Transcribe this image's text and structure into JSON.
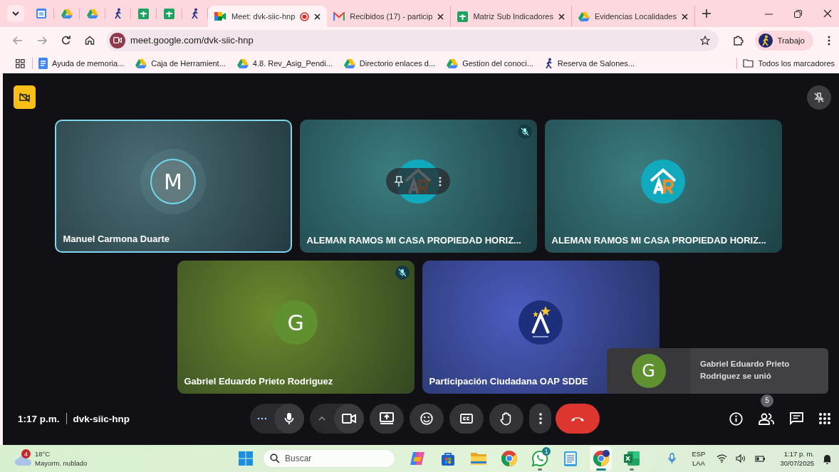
{
  "browser": {
    "tabs": [
      {
        "kind": "calendar",
        "selected": false
      },
      {
        "kind": "drive",
        "selected": false
      },
      {
        "kind": "drive",
        "selected": false
      },
      {
        "kind": "figure",
        "selected": false
      },
      {
        "kind": "sheets",
        "selected": false
      },
      {
        "kind": "sheets",
        "selected": false
      },
      {
        "kind": "figure",
        "selected": false
      },
      {
        "kind": "meet",
        "label": "Meet: dvk-siic-hnp",
        "recording": true,
        "selected": true
      },
      {
        "kind": "gmail",
        "label": "Recibidos (17) - particip",
        "recording": false,
        "selected": false
      },
      {
        "kind": "sheets",
        "label": "Matriz Sub Indicadores",
        "recording": false,
        "selected": false
      },
      {
        "kind": "drive",
        "label": "Evidencias Localidades",
        "recording": false,
        "selected": false
      }
    ],
    "url": "meet.google.com/dvk-siic-hnp",
    "profile": "Trabajo",
    "bookmarks": [
      {
        "kind": "doc",
        "label": "Ayuda de memoria..."
      },
      {
        "kind": "drive",
        "label": "Caja de Herramient..."
      },
      {
        "kind": "drive",
        "label": "4.8. Rev_Asig_Pendi..."
      },
      {
        "kind": "drive",
        "label": "Directorio enlaces d..."
      },
      {
        "kind": "drive",
        "label": "Gestion del conoci..."
      },
      {
        "kind": "figure",
        "label": "Reserva de Salones..."
      }
    ],
    "all_bookmarks": "Todos los marcadores"
  },
  "meet": {
    "tiles": [
      {
        "name": "Manuel Carmona Duarte",
        "kind": "letter",
        "letter": "M",
        "color": "#4a6e74",
        "speaking": true,
        "muted": false,
        "hovered": false
      },
      {
        "name": "ALEMAN RAMOS MI CASA PROPIEDAD HORIZ...",
        "kind": "house-logo",
        "color": "#3a7d80",
        "speaking": false,
        "muted": true,
        "hovered": true
      },
      {
        "name": "ALEMAN RAMOS MI CASA PROPIEDAD HORIZ...",
        "kind": "house-logo",
        "color": "#3a7d80",
        "speaking": false,
        "muted": false,
        "hovered": false
      },
      {
        "name": "Gabriel Eduardo Prieto Rodriguez",
        "kind": "letter",
        "letter": "G",
        "color": "#6b8a2c",
        "speaking": false,
        "muted": true,
        "hovered": false
      },
      {
        "name": "Participación Ciudadana OAP SDDE",
        "kind": "star-logo",
        "color": "#4b5cc0",
        "speaking": false,
        "muted": false,
        "hovered": false
      }
    ],
    "toast": {
      "letter": "G",
      "text": "Gabriel Eduardo Prieto Rodriguez se unió"
    },
    "time": "1:17 p.m.",
    "meeting_code": "dvk-siic-hnp",
    "controls": [
      {
        "kind": "mic"
      },
      {
        "kind": "camera"
      },
      {
        "kind": "present"
      },
      {
        "kind": "emoji"
      },
      {
        "kind": "captions"
      },
      {
        "kind": "hand"
      },
      {
        "kind": "more"
      },
      {
        "kind": "end"
      }
    ],
    "participants_count": "5"
  },
  "taskbar": {
    "weather_badge": "4",
    "temperature": "18°C",
    "weather": "Mayorm. nublado",
    "search_placeholder": "Buscar",
    "apps": [
      {
        "kind": "copilot",
        "running": false,
        "selected": false
      },
      {
        "kind": "store",
        "running": false,
        "selected": false
      },
      {
        "kind": "folder",
        "running": false,
        "selected": false
      },
      {
        "kind": "chrome",
        "running": false,
        "selected": false
      },
      {
        "kind": "whatsapp",
        "badge": "1",
        "running": true,
        "selected": false
      },
      {
        "kind": "notepad",
        "running": false,
        "selected": false
      },
      {
        "kind": "chrome-profile",
        "running": true,
        "selected": true
      },
      {
        "kind": "excel",
        "running": true,
        "selected": false
      }
    ],
    "language": "ESP",
    "layout": "LAA",
    "clock_time": "1:17 p. m.",
    "clock_date": "30/07/2025"
  }
}
